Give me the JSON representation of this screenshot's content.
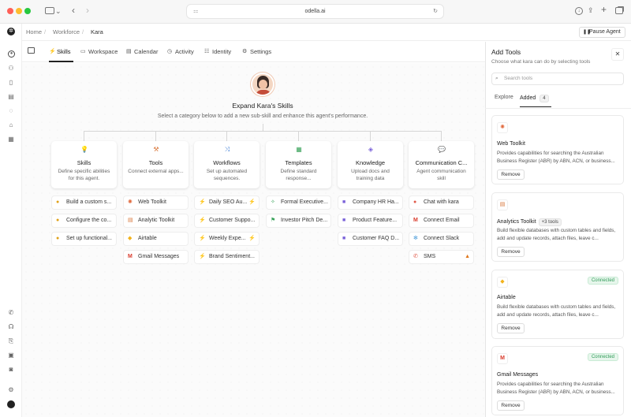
{
  "browser": {
    "url": "odella.ai",
    "colors": {
      "close": "#ff5f57",
      "minimize": "#febc2e",
      "maximize": "#28c840"
    }
  },
  "breadcrumb": {
    "home": "Home",
    "workforce": "Workforce",
    "agent": "Kara"
  },
  "pause_button": "Pause Agent",
  "tabs": [
    "Skills",
    "Workspace",
    "Calendar",
    "Activity",
    "Identity",
    "Settings"
  ],
  "hero": {
    "title": "Expand Kara's Skills",
    "subtitle": "Select a category below to add a new sub-skill and enhance this agent's performance."
  },
  "categories": [
    {
      "title": "Skills",
      "desc": "Define specific abilities for this agent.",
      "icon": "bulb-icon",
      "items": [
        "Build a custom s...",
        "Configure the co...",
        "Set up functional..."
      ]
    },
    {
      "title": "Tools",
      "desc": "Connect external apps...",
      "icon": "tools-icon",
      "items": [
        "Web Toolkit",
        "Analytic Toolkit",
        "Airtable",
        "Gmail Messages"
      ]
    },
    {
      "title": "Workflows",
      "desc": "Set up automated sequences.",
      "icon": "workflow-icon",
      "items": [
        "Daily SEO Au...",
        "Customer Suppo...",
        "Weekly Expe...",
        "Brand Sentiment..."
      ]
    },
    {
      "title": "Templates",
      "desc": "Define standard response...",
      "icon": "template-icon",
      "items": [
        "Formal Executive...",
        "Investor Pitch De..."
      ]
    },
    {
      "title": "Knowledge",
      "desc": "Upload docs and training data",
      "icon": "knowledge-icon",
      "items": [
        "Company HR Ha...",
        "Product Feature...",
        "Customer FAQ D..."
      ]
    },
    {
      "title": "Communication C...",
      "desc": "Agent communication skill",
      "icon": "chat-icon",
      "items": [
        "Chat with kara",
        "Connect Email",
        "Connect Slack",
        "SMS"
      ]
    }
  ],
  "panel": {
    "title": "Add Tools",
    "subtitle": "Choose what kara can do by selecting tools",
    "search_placeholder": "Search tools",
    "tabs": {
      "explore": "Explore",
      "added": "Added",
      "added_count": "4"
    },
    "tools": [
      {
        "name": "Web Toolkit",
        "desc": "Provides capabilities for searching the Australian Business Register (ABR) by ABN, ACN, or business...",
        "action": "Remove"
      },
      {
        "name": "Analytics Toolkit",
        "badge": "+3 tools",
        "desc": "Build flexible databases with custom tables and fields, add and update records, attach files, leave c...",
        "action": "Remove"
      },
      {
        "name": "Airtable",
        "status": "Connected",
        "desc": "Build flexible databases with custom tables and fields, add and update records, attach files, leave c...",
        "action": "Remove"
      },
      {
        "name": "Gmail Messages",
        "status": "Connected",
        "desc": "Provides capabilities for searching the Australian Business Register (ABR) by ABN, ACN, or business...",
        "action": "Remove"
      }
    ]
  }
}
